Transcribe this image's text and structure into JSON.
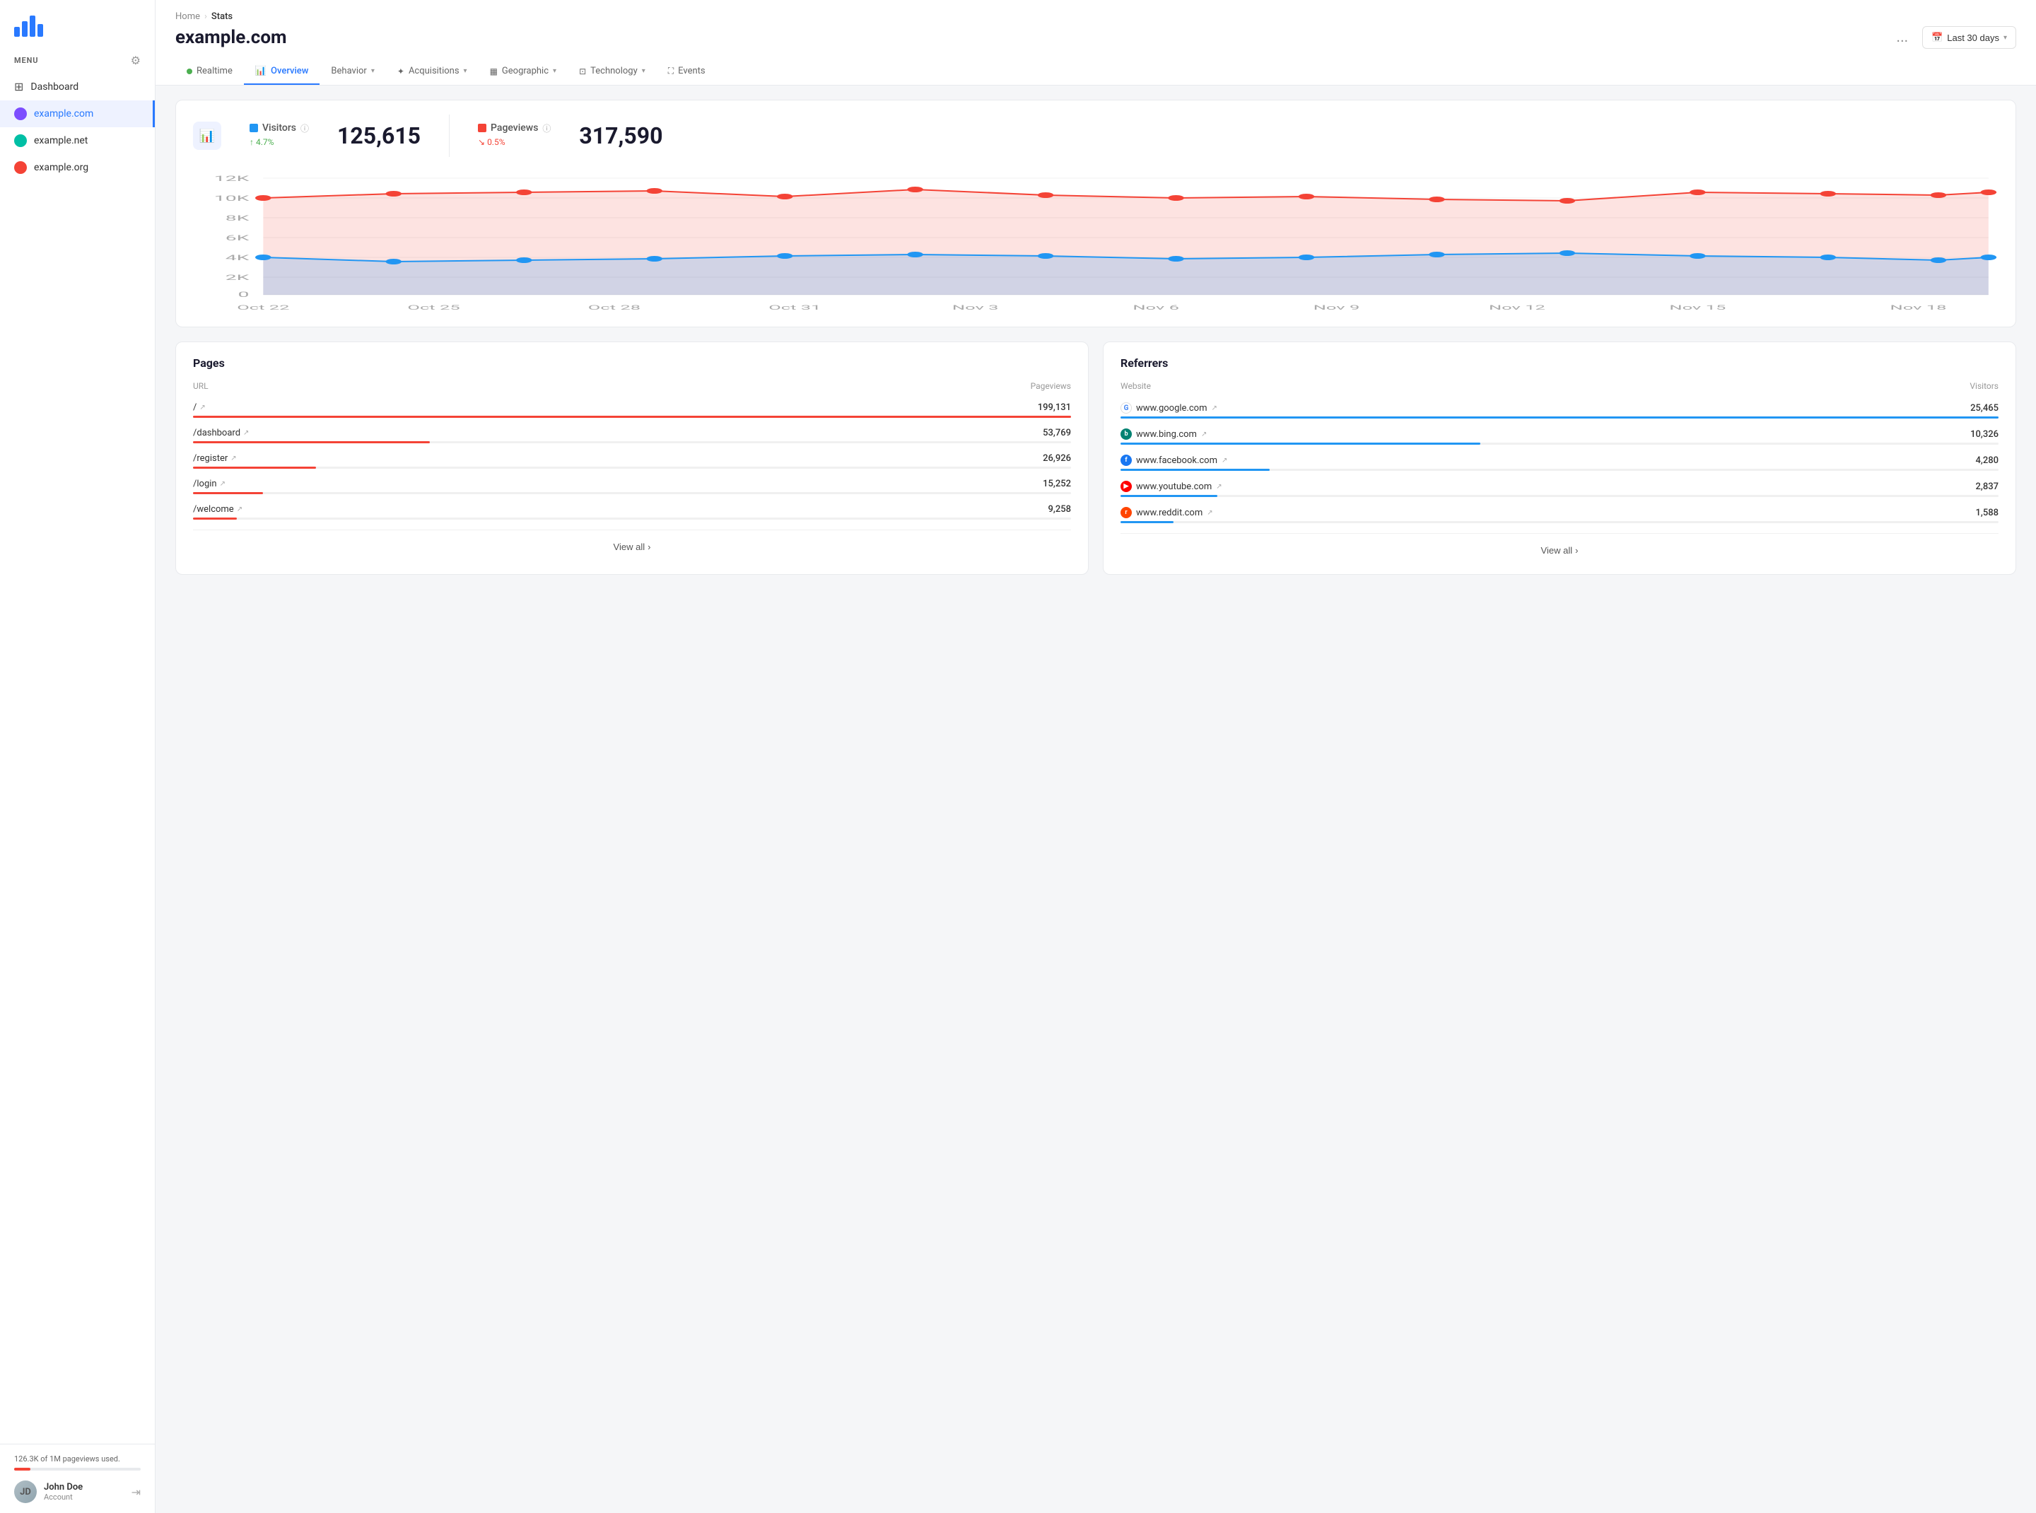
{
  "sidebar": {
    "menu_label": "MENU",
    "nav": {
      "dashboard": "Dashboard"
    },
    "sites": [
      {
        "name": "example.com",
        "dot": "purple",
        "active": true
      },
      {
        "name": "example.net",
        "dot": "green",
        "active": false
      },
      {
        "name": "example.org",
        "dot": "red",
        "active": false
      }
    ],
    "usage_text": "126.3K of 1M pageviews used.",
    "user": {
      "name": "John Doe",
      "account": "Account"
    }
  },
  "header": {
    "breadcrumb_home": "Home",
    "breadcrumb_current": "Stats",
    "title": "example.com",
    "dots_label": "...",
    "date_range": "Last 30 days",
    "tabs": [
      {
        "id": "realtime",
        "label": "Realtime",
        "type": "dot"
      },
      {
        "id": "overview",
        "label": "Overview",
        "type": "icon",
        "active": true
      },
      {
        "id": "behavior",
        "label": "Behavior",
        "type": "dropdown"
      },
      {
        "id": "acquisitions",
        "label": "Acquisitions",
        "type": "dropdown"
      },
      {
        "id": "geographic",
        "label": "Geographic",
        "type": "dropdown"
      },
      {
        "id": "technology",
        "label": "Technology",
        "type": "dropdown"
      },
      {
        "id": "events",
        "label": "Events",
        "type": "icon"
      }
    ]
  },
  "stats": {
    "visitors_label": "Visitors",
    "visitors_change": "4.7%",
    "visitors_change_direction": "up",
    "visitors_value": "125,615",
    "pageviews_label": "Pageviews",
    "pageviews_change": "0.5%",
    "pageviews_change_direction": "down",
    "pageviews_value": "317,590"
  },
  "chart": {
    "y_labels": [
      "12K",
      "10K",
      "8K",
      "6K",
      "4K",
      "2K",
      "0"
    ],
    "x_labels": [
      "Oct 22",
      "Oct 25",
      "Oct 28",
      "Oct 31",
      "Nov 3",
      "Nov 6",
      "Nov 9",
      "Nov 12",
      "Nov 15",
      "Nov 18"
    ]
  },
  "pages": {
    "title": "Pages",
    "col_url": "URL",
    "col_pageviews": "Pageviews",
    "rows": [
      {
        "url": "/",
        "value": "199,131",
        "pct": 100
      },
      {
        "url": "/dashboard",
        "value": "53,769",
        "pct": 27
      },
      {
        "url": "/register",
        "value": "26,926",
        "pct": 14
      },
      {
        "url": "/login",
        "value": "15,252",
        "pct": 8
      },
      {
        "url": "/welcome",
        "value": "9,258",
        "pct": 5
      }
    ],
    "view_all": "View all"
  },
  "referrers": {
    "title": "Referrers",
    "col_website": "Website",
    "col_visitors": "Visitors",
    "rows": [
      {
        "name": "www.google.com",
        "icon": "google",
        "value": "25,465",
        "pct": 100
      },
      {
        "name": "www.bing.com",
        "icon": "bing",
        "value": "10,326",
        "pct": 41
      },
      {
        "name": "www.facebook.com",
        "icon": "facebook",
        "value": "4,280",
        "pct": 17
      },
      {
        "name": "www.youtube.com",
        "icon": "youtube",
        "value": "2,837",
        "pct": 11
      },
      {
        "name": "www.reddit.com",
        "icon": "reddit",
        "value": "1,588",
        "pct": 6
      }
    ],
    "view_all": "View all"
  }
}
